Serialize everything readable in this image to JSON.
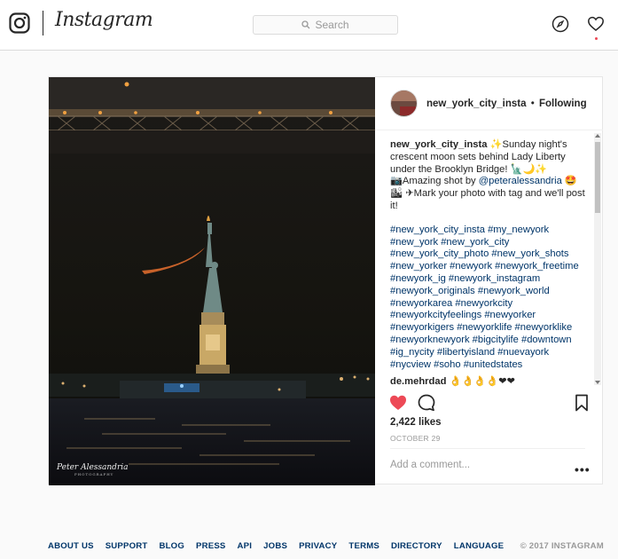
{
  "header": {
    "brand": "Instagram",
    "search_placeholder": "Search"
  },
  "post": {
    "username": "new_york_city_insta",
    "separator": "•",
    "follow_state": "Following",
    "avatar_text": "YORK CITY",
    "photo_credit": "Peter Alessandria",
    "photo_credit_sub": "PHOTOGRAPHY",
    "caption": {
      "username": "new_york_city_insta",
      "line1": " ✨Sunday night's crescent moon sets behind Lady Liberty under the Brooklyn Bridge! 🗽🌙✨",
      "line2_prefix": "📷Amazing shot by ",
      "mention": "@peteralessandria",
      "line2_suffix": " 🤩",
      "line3": "🏙           ✈Mark your photo with tag and we'll post it!",
      "hashtags": "                          #new_york_city_insta #my_newyork #new_york #new_york_city #new_york_city_photo #new_york_shots #new_yorker #newyork #newyork_freetime #newyork_ig #newyork_instagram #newyork_originals #newyork_world #newyorkarea #newyorkcity #newyorkcityfeelings #newyorker #newyorkigers #newyorklife #newyorklike #newyorknewyork #bigcitylife #downtown #ig_nycity #libertyisland #nuevayork #nycview #soho #unitedstates"
    },
    "comment": {
      "username": "de.mehrdad",
      "text": " 👌👌👌👌❤❤"
    },
    "likes": "2,422 likes",
    "date": "OCTOBER 29",
    "comment_placeholder": "Add a comment...",
    "more_label": "•••",
    "liked_color": "#ed4956"
  },
  "footer": {
    "links": [
      "ABOUT US",
      "SUPPORT",
      "BLOG",
      "PRESS",
      "API",
      "JOBS",
      "PRIVACY",
      "TERMS",
      "DIRECTORY",
      "LANGUAGE"
    ],
    "copyright": "© 2017 INSTAGRAM"
  },
  "icons": {
    "logo": "instagram-glyph-icon",
    "search": "search-icon",
    "explore": "compass-icon",
    "activity": "heart-outline-icon",
    "like": "heart-filled-icon",
    "comment": "speech-bubble-icon",
    "save": "bookmark-icon"
  }
}
